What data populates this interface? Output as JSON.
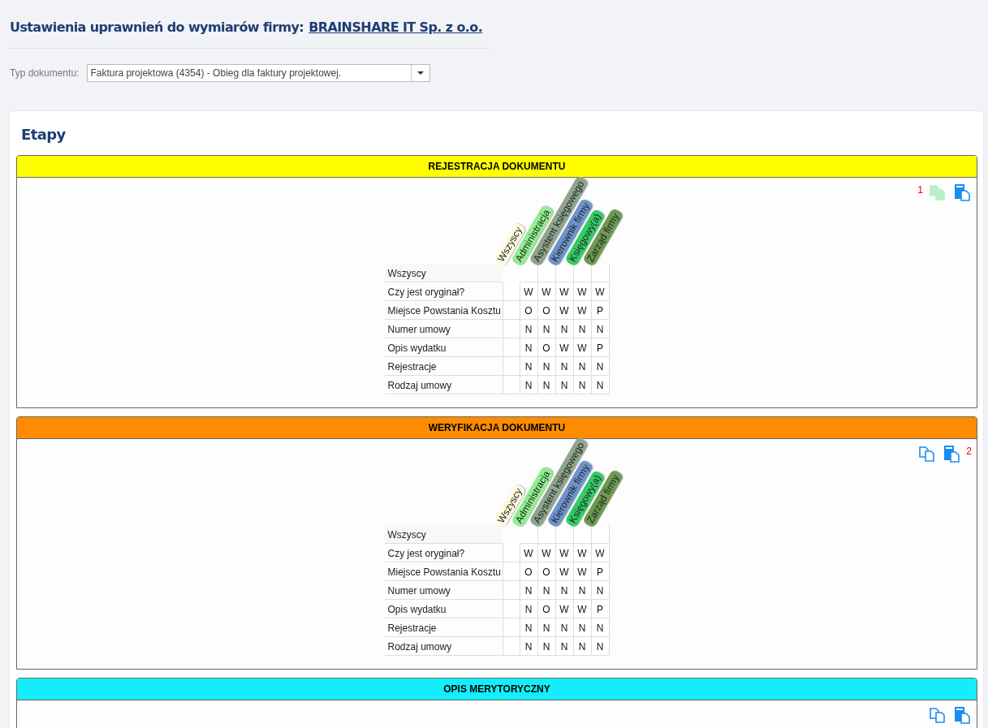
{
  "header": {
    "title": "Ustawienia uprawnień do wymiarów firmy:",
    "company_link": "BRAINSHARE IT Sp. z o.o."
  },
  "document_type": {
    "label": "Typ dokumentu:",
    "value": "Faktura projektowa (4354) - Obieg dla faktury projektowej."
  },
  "section": {
    "title": "Etapy"
  },
  "stages": [
    {
      "title": "REJESTRACJA DOKUMENTU",
      "color": "#ffff00",
      "actions": [
        {
          "kind": "copy",
          "disabled": true,
          "badge": "1"
        },
        {
          "kind": "paste",
          "disabled": false
        }
      ],
      "roles": [
        {
          "name": "Wszyscy",
          "color": "#fffbe0"
        },
        {
          "name": "Administracja",
          "color": "#90ee90"
        },
        {
          "name": "Asystent księgowego",
          "color": "#8da58c"
        },
        {
          "name": "Kierownik firmy",
          "color": "#6d93cc"
        },
        {
          "name": "Księgowy(a)",
          "color": "#33cc66"
        },
        {
          "name": "Zarząd firmy",
          "color": "#6b9a50"
        }
      ],
      "rows": [
        {
          "kind": "all",
          "label": "Wszyscy"
        },
        {
          "kind": "field",
          "label": "Czy jest oryginał?",
          "values": [
            "W",
            "W",
            "W",
            "W",
            "W"
          ]
        },
        {
          "kind": "field",
          "label": "Miejsce Powstania Kosztu",
          "values": [
            "O",
            "O",
            "W",
            "W",
            "P"
          ]
        },
        {
          "kind": "field",
          "label": "Numer umowy",
          "values": [
            "N",
            "N",
            "N",
            "N",
            "N"
          ]
        },
        {
          "kind": "field",
          "label": "Opis wydatku",
          "values": [
            "N",
            "O",
            "W",
            "W",
            "P"
          ]
        },
        {
          "kind": "field",
          "label": "Rejestracje",
          "values": [
            "N",
            "N",
            "N",
            "N",
            "N"
          ]
        },
        {
          "kind": "field",
          "label": "Rodzaj umowy",
          "values": [
            "N",
            "N",
            "N",
            "N",
            "N"
          ]
        }
      ]
    },
    {
      "title": "WERYFIKACJA DOKUMENTU",
      "color": "#ff8c00",
      "actions": [
        {
          "kind": "copy",
          "disabled": false
        },
        {
          "kind": "paste",
          "disabled": false,
          "badge": "2"
        }
      ],
      "roles": [
        {
          "name": "Wszyscy",
          "color": "#fffbe0"
        },
        {
          "name": "Administracja",
          "color": "#90ee90"
        },
        {
          "name": "Asystent księgowego",
          "color": "#8da58c"
        },
        {
          "name": "Kierownik firmy",
          "color": "#6d93cc"
        },
        {
          "name": "Księgowy(a)",
          "color": "#33cc66"
        },
        {
          "name": "Zarząd firmy",
          "color": "#6b9a50"
        }
      ],
      "rows": [
        {
          "kind": "all",
          "label": "Wszyscy"
        },
        {
          "kind": "field",
          "label": "Czy jest oryginał?",
          "values": [
            "W",
            "W",
            "W",
            "W",
            "W"
          ]
        },
        {
          "kind": "field",
          "label": "Miejsce Powstania Kosztu",
          "values": [
            "O",
            "O",
            "W",
            "W",
            "P"
          ]
        },
        {
          "kind": "field",
          "label": "Numer umowy",
          "values": [
            "N",
            "N",
            "N",
            "N",
            "N"
          ]
        },
        {
          "kind": "field",
          "label": "Opis wydatku",
          "values": [
            "N",
            "O",
            "W",
            "W",
            "P"
          ]
        },
        {
          "kind": "field",
          "label": "Rejestracje",
          "values": [
            "N",
            "N",
            "N",
            "N",
            "N"
          ]
        },
        {
          "kind": "field",
          "label": "Rodzaj umowy",
          "values": [
            "N",
            "N",
            "N",
            "N",
            "N"
          ]
        }
      ]
    },
    {
      "title": "OPIS MERYTORYCZNY",
      "color": "#14eefc",
      "actions": [
        {
          "kind": "copy",
          "disabled": false
        },
        {
          "kind": "paste",
          "disabled": false
        }
      ]
    }
  ]
}
